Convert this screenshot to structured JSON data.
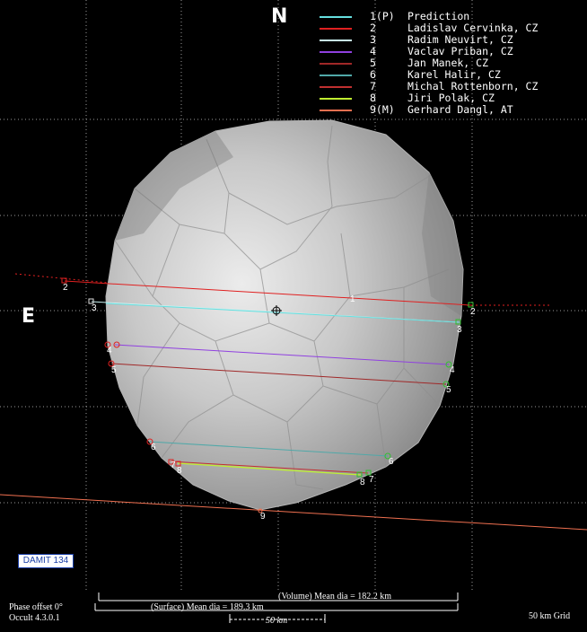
{
  "north_label": "N",
  "east_label": "E",
  "legend": [
    {
      "num": "1(P)",
      "name": "Prediction",
      "color": "#66e0e0"
    },
    {
      "num": "2",
      "name": "Ladislav Cervinka, CZ",
      "color": "#e02020"
    },
    {
      "num": "3",
      "name": "Radim Neuvirt, CZ",
      "color": "#c8f0f0"
    },
    {
      "num": "4",
      "name": "Vaclav Priban, CZ",
      "color": "#9040e0"
    },
    {
      "num": "5",
      "name": "Jan Manek, CZ",
      "color": "#a02828"
    },
    {
      "num": "6",
      "name": "Karel Halir, CZ",
      "color": "#50a8a8"
    },
    {
      "num": "7",
      "name": "Michal Rottenborn, CZ",
      "color": "#c03030"
    },
    {
      "num": "8",
      "name": "Jiri Polak, CZ",
      "color": "#c0f030"
    },
    {
      "num": "9(M)",
      "name": "Gerhard Dangl, AT",
      "color": "#f07050"
    }
  ],
  "chord_labels": [
    "1",
    "2",
    "3",
    "4",
    "5",
    "6",
    "7",
    "8",
    "9"
  ],
  "damit_label": "DAMIT 134",
  "volume_label": "(Volume) Mean dia = 182.2 km",
  "surface_label": "(Surface) Mean dia = 189.3 km",
  "scale_label": "50 km",
  "phase_offset": "Phase offset 0°",
  "occult_version": "Occult 4.3.0.1",
  "grid_label": "50 km Grid"
}
